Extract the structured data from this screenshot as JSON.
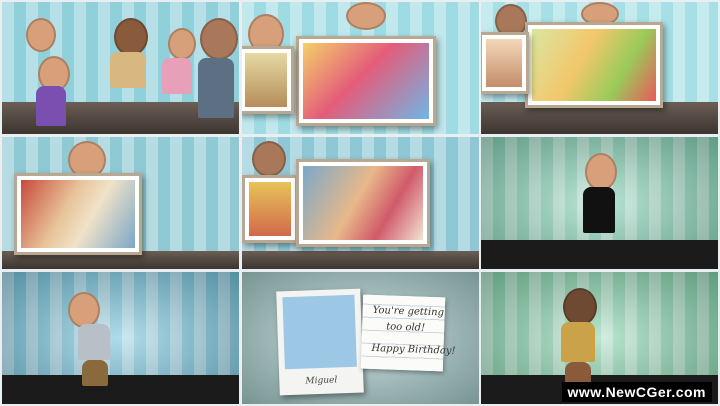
{
  "tiles": [
    {
      "id": "group-dance",
      "background": "#8fd0db"
    },
    {
      "id": "party-kids-photo",
      "background": "#9fdbe3"
    },
    {
      "id": "cake-girl-photo",
      "background": "#a6e0e6"
    },
    {
      "id": "siblings-cake-photo",
      "background": "#8fc9d4"
    },
    {
      "id": "party-horn-photo",
      "background": "#8ec8d6"
    },
    {
      "id": "woman-dancing",
      "background": "#7fcfb2"
    },
    {
      "id": "boy-dancing",
      "background": "#6fbfd8"
    },
    {
      "id": "birthday-card",
      "background": "#9fc5c4"
    },
    {
      "id": "man-dancing",
      "background": "#7fd0a7"
    }
  ],
  "card": {
    "note_line1": "You're getting",
    "note_line2": "too old!",
    "note_line3": "Happy Birthday!",
    "polaroid_caption": "Miguel"
  },
  "watermark": "www.NewCGer.com"
}
